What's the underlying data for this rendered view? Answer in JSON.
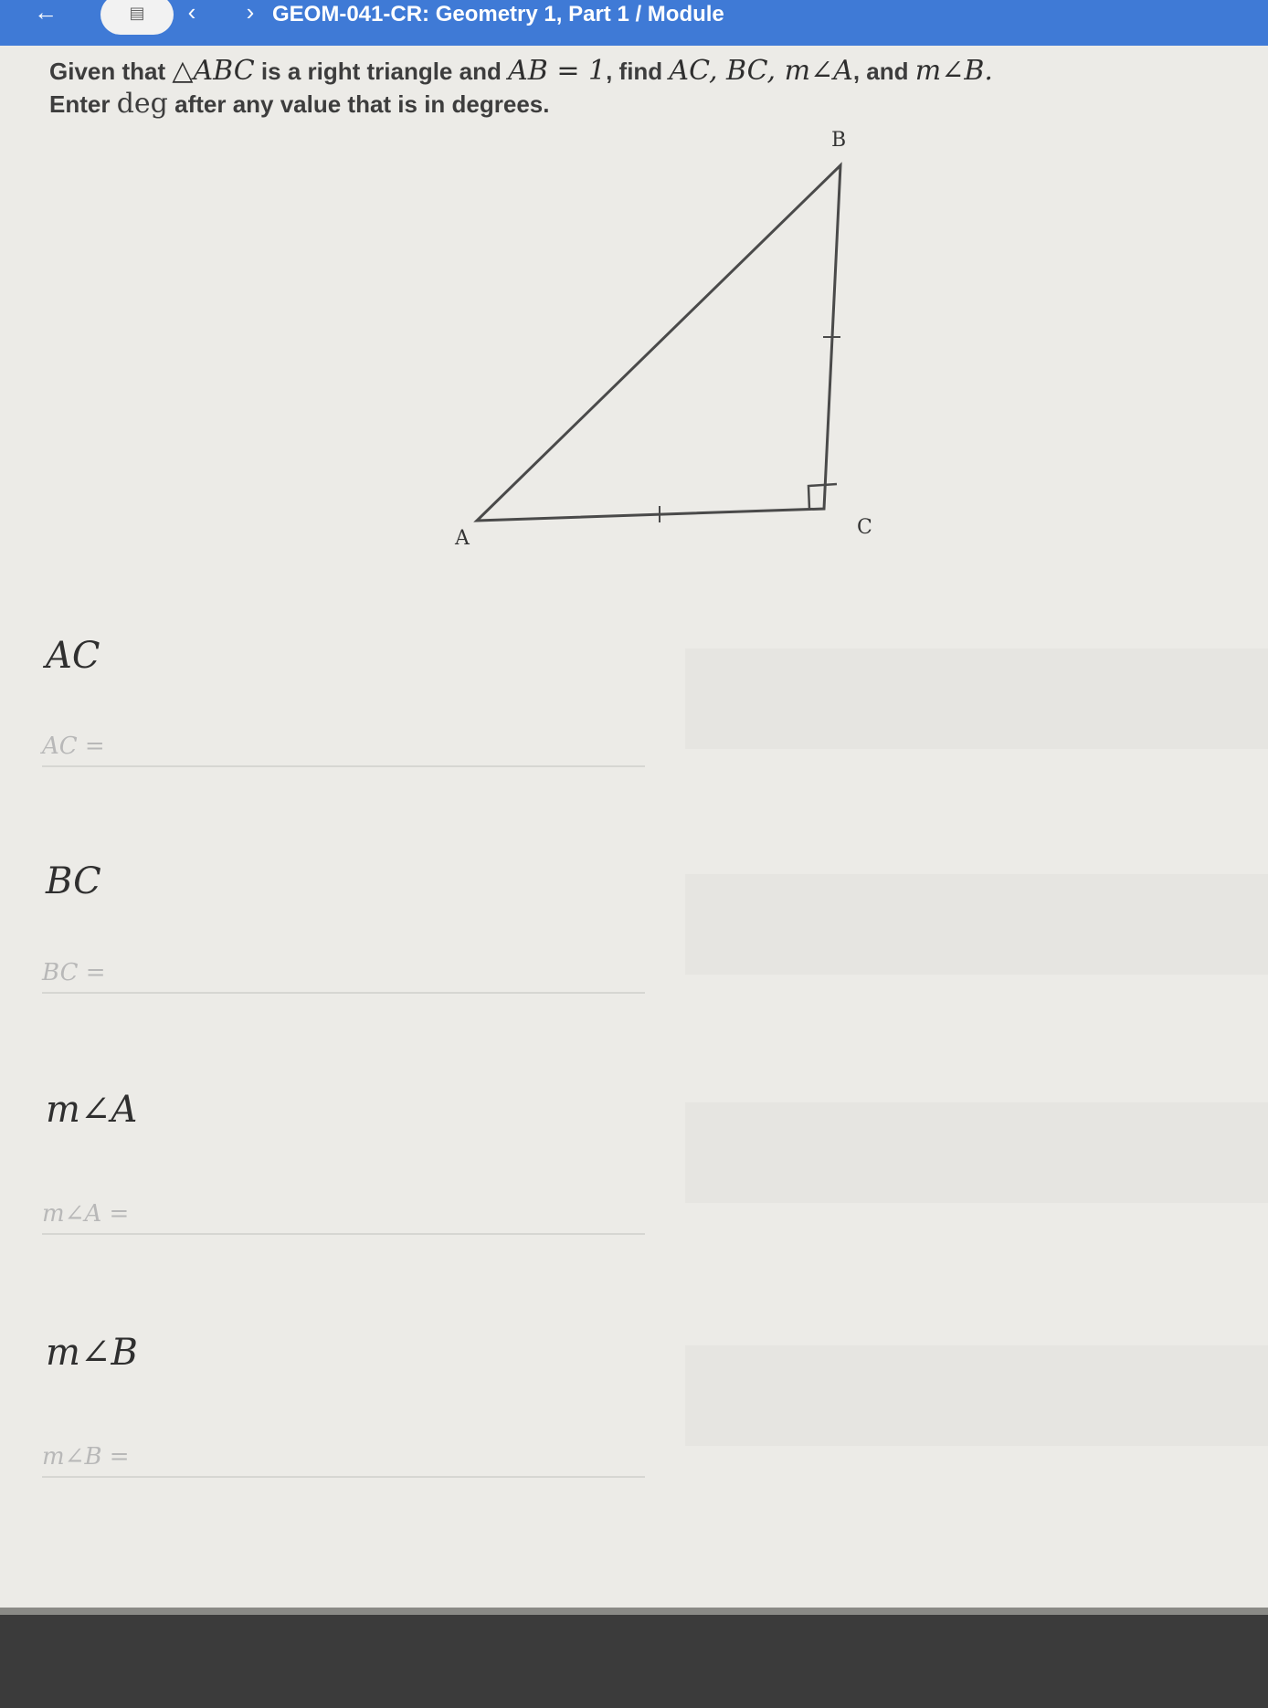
{
  "topbar": {
    "breadcrumb": "GEOM-041-CR: Geometry 1, Part 1 / Module",
    "back_icon": "arrow-left-icon",
    "save_icon": "save-icon",
    "prev_icon": "chevron-left-icon",
    "next_icon": "chevron-right-icon",
    "accent_color": "#3f7ad6"
  },
  "problem": {
    "text_given": "Given that",
    "triangle": "△ABC",
    "text_is_right": "is a right triangle and",
    "ab_eq": "AB = 1",
    "text_find": ", find",
    "targets": "AC, BC, m∠A",
    "text_and": ", and",
    "target_last": "m∠B.",
    "line2_pre": "Enter",
    "line2_deg": "deg",
    "line2_post": "after any value that is in degrees."
  },
  "diagram": {
    "vertex_a": "A",
    "vertex_b": "B",
    "vertex_c": "C"
  },
  "answers": [
    {
      "heading": "AC",
      "field_label": "AC =",
      "value": ""
    },
    {
      "heading": "BC",
      "field_label": "BC =",
      "value": ""
    },
    {
      "heading": "m∠A",
      "field_label": "m∠A =",
      "value": ""
    },
    {
      "heading": "m∠B",
      "field_label": "m∠B =",
      "value": ""
    }
  ]
}
